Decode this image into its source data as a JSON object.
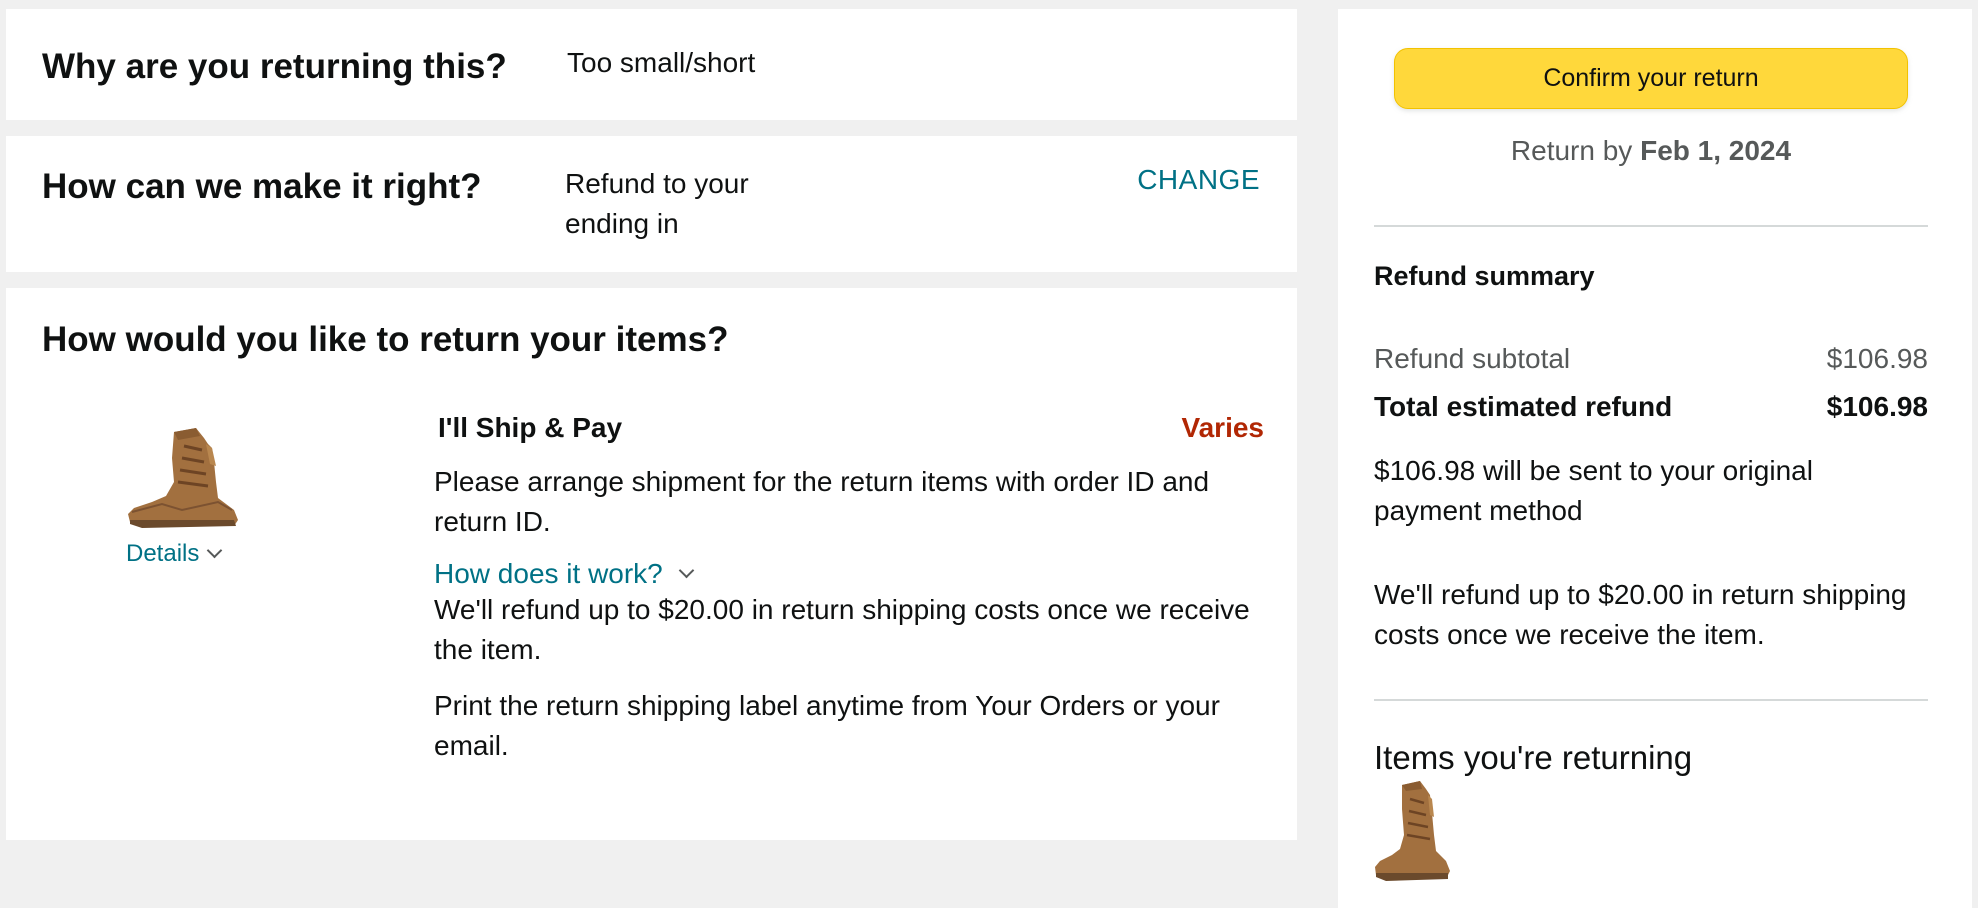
{
  "reason": {
    "title": "Why are you returning this?",
    "value": "Too small/short"
  },
  "resolution": {
    "title": "How can we make it right?",
    "value_line1": "Refund to your",
    "value_line2": "ending in",
    "change_label": "CHANGE"
  },
  "return_method": {
    "title": "How would you like to return your items?",
    "item": {
      "image_icon": "boot-icon",
      "details_label": "Details"
    },
    "option": {
      "title": "I'll Ship & Pay",
      "price": "Varies",
      "instructions": "Please arrange shipment for the return items with order ID and return ID.",
      "how_link": "How does it work?",
      "refund_note": "We'll refund up to $20.00 in return shipping costs once we receive the item.",
      "print_note": "Print the return shipping label anytime from Your Orders or your email."
    }
  },
  "summary": {
    "confirm_label": "Confirm your return",
    "return_by_prefix": "Return by",
    "return_by_date": "Feb 1, 2024",
    "refund_summary_title": "Refund summary",
    "subtotal_label": "Refund subtotal",
    "subtotal_value": "$106.98",
    "total_label": "Total estimated refund",
    "total_value": "$106.98",
    "payment_note": "$106.98 will be sent to your original payment method",
    "shipping_note": "We'll refund up to $20.00 in return shipping costs once we receive the item.",
    "items_title": "Items you're returning"
  },
  "colors": {
    "link": "#007185",
    "price_red": "#b12704",
    "button_yellow": "#ffd83b",
    "background": "#f0f0f0"
  }
}
